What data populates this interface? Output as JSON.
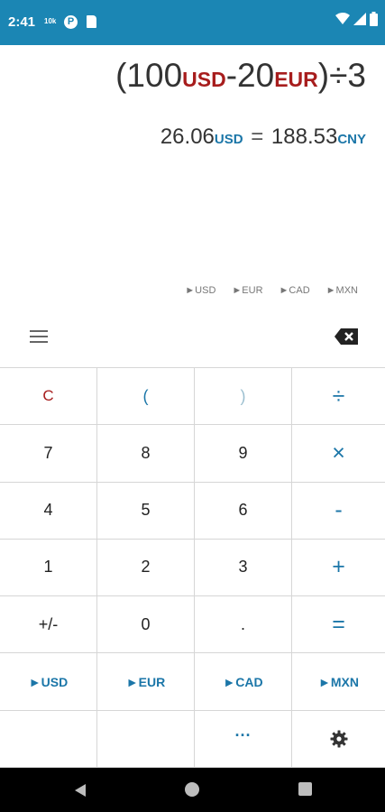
{
  "status_bar": {
    "time": "2:41",
    "small_text": "10k",
    "icons": [
      "p-badge-icon",
      "sd-card-icon",
      "wifi-icon",
      "signal-icon",
      "battery-icon"
    ],
    "background": "#1b86b4"
  },
  "display": {
    "expression": {
      "open": "(100",
      "cur1": "USD",
      "minus": "-20",
      "cur2": "EUR",
      "close": ")÷3"
    },
    "result": {
      "value": "26.06",
      "from_currency": "USD",
      "equals": "=",
      "converted": "188.53",
      "to_currency": "CNY"
    }
  },
  "quick_currencies": [
    "►USD",
    "►EUR",
    "►CAD",
    "►MXN"
  ],
  "toolbar": {
    "menu_icon": "hamburger-menu-icon",
    "backspace_icon": "backspace-icon"
  },
  "keypad": {
    "clear": "C",
    "open_paren": "(",
    "close_paren": ")",
    "divide": "÷",
    "k7": "7",
    "k8": "8",
    "k9": "9",
    "multiply": "×",
    "k4": "4",
    "k5": "5",
    "k6": "6",
    "minus": "-",
    "k1": "1",
    "k2": "2",
    "k3": "3",
    "plus": "+",
    "sign": "+/-",
    "k0": "0",
    "dot": ".",
    "equals": "=",
    "cur_usd": "►USD",
    "cur_eur": "►EUR",
    "cur_cad": "►CAD",
    "cur_mxn": "►MXN",
    "more": "···",
    "settings_icon": "gear-icon"
  },
  "colors": {
    "accent_blue": "#1b76a8",
    "accent_red": "#a71d1d"
  },
  "nav_bar": {
    "icons": [
      "back-icon",
      "home-icon",
      "recents-icon"
    ]
  }
}
